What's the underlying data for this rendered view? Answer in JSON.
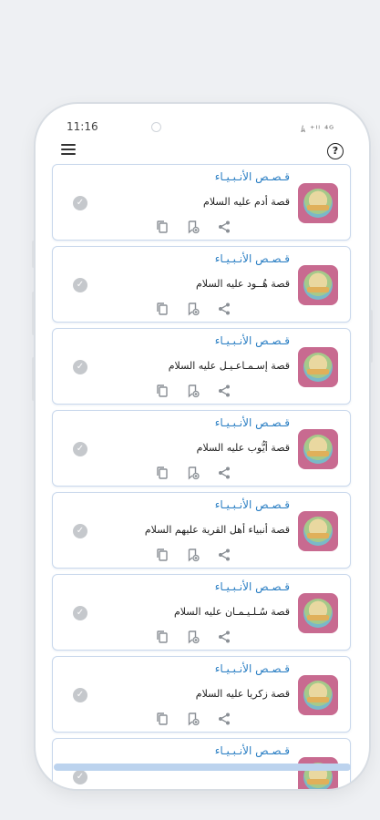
{
  "status": {
    "time": "11:16",
    "icons": "ﾑ ⁺ᴵˡ ⁴ᴳ"
  },
  "appbar": {
    "menu_icon": "menu-icon",
    "help_icon": "help-icon",
    "help_glyph": "?"
  },
  "icons": {
    "check": "✓"
  },
  "cards": [
    {
      "category": "قـصـص الأنـبـيـاء",
      "title": "قصة أدم عليه السلام"
    },
    {
      "category": "قـصـص الأنـبـيـاء",
      "title": "قصة هُــود عليه السلام"
    },
    {
      "category": "قـصـص الأنـبـيـاء",
      "title": "قصة إسـمـاعـيـل عليه السلام"
    },
    {
      "category": "قـصـص الأنـبـيـاء",
      "title": "قصة أيُّوب عليه السلام"
    },
    {
      "category": "قـصـص الأنـبـيـاء",
      "title": "قصة أنبياء أهل القرية عليهم السلام"
    },
    {
      "category": "قـصـص الأنـبـيـاء",
      "title": "قصة سُـلـيـمـان عليه السلام"
    },
    {
      "category": "قـصـص الأنـبـيـاء",
      "title": "قصة زكريا عليه السلام"
    },
    {
      "category": "قـصـص الأنـبـيـاء",
      "title": ""
    }
  ],
  "colors": {
    "accent": "#2b7fc4",
    "card_border": "#c9d8ec",
    "thumb_bg": "#c86a90"
  }
}
